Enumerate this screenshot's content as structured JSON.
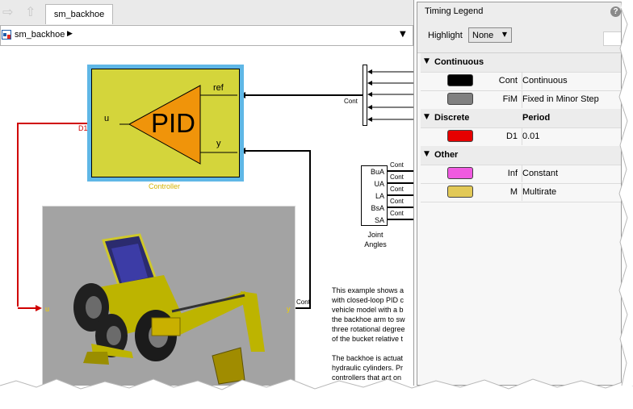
{
  "window": {
    "tab_label": "sm_backhoe",
    "path_label": "sm_backhoe"
  },
  "icons": {
    "back": "arrow-left-icon",
    "up": "arrow-up-icon",
    "model": "simulink-model-icon",
    "chevron": "chevron-right-icon",
    "dropdown": "chevron-down-icon",
    "help": "help-icon",
    "group_toggle": "caret-down-icon"
  },
  "diagram": {
    "controller": {
      "block_text": "PID",
      "in_port": "u",
      "ref_port": "ref",
      "y_port": "y",
      "caption": "Controller",
      "signal_in_label": "D1"
    },
    "mux_label": "Cont",
    "joint_angles": {
      "ports": [
        "BuA",
        "UA",
        "LA",
        "BsA",
        "SA"
      ],
      "signal_labels": [
        "Cont",
        "Cont",
        "Cont",
        "Cont",
        "Cont"
      ],
      "caption_line1": "Joint",
      "caption_line2": "Angles"
    },
    "plant": {
      "in_port": "u",
      "out_port": "y",
      "out_signal_label": "Cont"
    },
    "description": {
      "para1": [
        "This example shows a",
        "with closed-loop PID c",
        "vehicle model with a b",
        "the backhoe arm to sw",
        "three rotational degree",
        "of the bucket relative t"
      ],
      "para2": [
        "The backhoe is actuat",
        "hydraulic cylinders. Pr",
        "controllers that act on"
      ]
    }
  },
  "legend": {
    "title": "Timing Legend",
    "highlight_label": "Highlight",
    "highlight_value": "None",
    "groups": {
      "continuous": {
        "label": "Continuous",
        "rows": [
          {
            "color": "#000000",
            "annotation": "Cont",
            "description": "Continuous"
          },
          {
            "color": "#808080",
            "annotation": "FiM",
            "description": "Fixed in Minor Step"
          }
        ]
      },
      "discrete": {
        "label": "Discrete",
        "period_header": "Period",
        "rows": [
          {
            "color": "#e60000",
            "annotation": "D1",
            "description": "0.01"
          }
        ]
      },
      "other": {
        "label": "Other",
        "rows": [
          {
            "color": "#f05ae0",
            "annotation": "Inf",
            "description": "Constant"
          },
          {
            "color": "#e2c957",
            "annotation": "M",
            "description": "Multirate"
          }
        ]
      }
    }
  },
  "colors": {
    "controller_fill": "#d4d53b",
    "controller_highlight": "#5fb7e6",
    "pid_triangle": "#f0940a",
    "signal_red": "#d00000",
    "caption_yellow": "#d4b200"
  }
}
